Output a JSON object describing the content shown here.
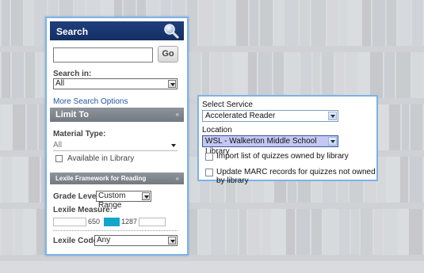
{
  "search_panel": {
    "title": "Search",
    "query_value": "",
    "go_label": "Go",
    "search_in_label": "Search in:",
    "search_in_value": "All",
    "more_options_link": "More Search Options",
    "limit_to_title": "Limit To",
    "material_type_label": "Material Type:",
    "material_type_value": "All",
    "available_in_library_label": "Available in Library",
    "available_in_library_checked": false,
    "lexile_section_title": "Lexile Framework for Reading",
    "grade_level_label": "Grade Level:",
    "grade_level_value": "Custom Range",
    "lexile_measure_label": "Lexile Measure:",
    "lexile_min": "650",
    "lexile_max": "1287",
    "lexile_code_label": "Lexile Code:",
    "lexile_code_value": "Any",
    "collapse_glyph": "«"
  },
  "service_dialog": {
    "select_service_label": "Select Service",
    "service_value": "Accelerated Reader",
    "location_label": "Location",
    "location_value": "WSL - Walkerton Middle School Library",
    "import_label": "Import list of quizzes owned by library",
    "import_checked": false,
    "update_label": "Update MARC records for quizzes not owned by library",
    "update_checked": false
  },
  "icons": {
    "search": "magnifier-icon",
    "dropdown": "chevron-down-icon",
    "collapse": "double-chevron-up-icon"
  },
  "colors": {
    "header_navy": "#1f3f7d",
    "band_gray": "#80868d",
    "panel_border": "#7fb2e6",
    "link_blue": "#2356a3",
    "lexile_range_fill": "#13a5cc",
    "location_highlight": "#c4c7f2"
  }
}
